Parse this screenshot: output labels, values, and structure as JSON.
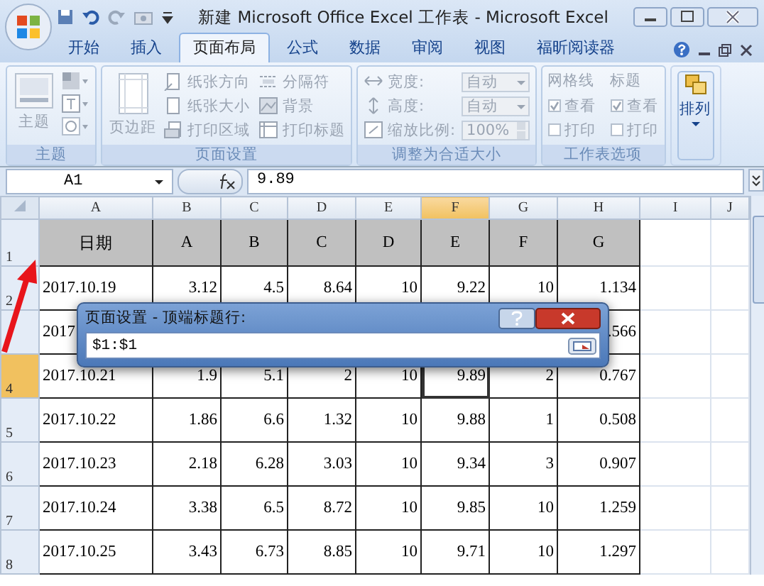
{
  "window": {
    "title": "新建 Microsoft Office Excel 工作表 - Microsoft Excel"
  },
  "tabs": [
    {
      "label": "开始",
      "selected": false
    },
    {
      "label": "插入",
      "selected": false
    },
    {
      "label": "页面布局",
      "selected": true
    },
    {
      "label": "公式",
      "selected": false
    },
    {
      "label": "数据",
      "selected": false
    },
    {
      "label": "审阅",
      "selected": false
    },
    {
      "label": "视图",
      "selected": false
    },
    {
      "label": "福昕阅读器",
      "selected": false
    }
  ],
  "ribbon": {
    "themes": {
      "label": "主题",
      "button": "主题"
    },
    "page_setup": {
      "label": "页面设置",
      "button": "页边距",
      "items": [
        "纸张方向",
        "分隔符",
        "纸张大小",
        "背景",
        "打印区域",
        "打印标题"
      ]
    },
    "scale_to_fit": {
      "label": "调整为合适大小",
      "fields": [
        {
          "label": "宽度:",
          "value": "自动",
          "kind": "dropdown"
        },
        {
          "label": "高度:",
          "value": "自动",
          "kind": "dropdown"
        },
        {
          "label": "缩放比例:",
          "value": "100%",
          "kind": "spinner"
        }
      ]
    },
    "sheet_options": {
      "label": "工作表选项",
      "groups": [
        {
          "label": "网格线",
          "options": [
            {
              "label": "查看",
              "checked": true
            },
            {
              "label": "打印",
              "checked": false
            }
          ]
        },
        {
          "label": "标题",
          "options": [
            {
              "label": "查看",
              "checked": true
            },
            {
              "label": "打印",
              "checked": false
            }
          ]
        }
      ]
    },
    "arrange": {
      "button": "排列"
    }
  },
  "formula_bar": {
    "name_box": "A1",
    "formula": "9.89"
  },
  "columns": [
    {
      "label": "A",
      "selected": false
    },
    {
      "label": "B",
      "selected": false
    },
    {
      "label": "C",
      "selected": false
    },
    {
      "label": "D",
      "selected": false
    },
    {
      "label": "E",
      "selected": false
    },
    {
      "label": "F",
      "selected": true
    },
    {
      "label": "G",
      "selected": false
    },
    {
      "label": "H",
      "selected": false
    },
    {
      "label": "I",
      "selected": false
    },
    {
      "label": "J",
      "selected": false
    }
  ],
  "rows": [
    {
      "number": "1",
      "selected": false,
      "kind": "header",
      "cells": [
        "日期",
        "A",
        "B",
        "C",
        "D",
        "E",
        "F",
        "G"
      ]
    },
    {
      "number": "2",
      "selected": false,
      "kind": "data",
      "cells": [
        "2017.10.19",
        "3.12",
        "4.5",
        "8.64",
        "10",
        "9.22",
        "10",
        "1.134"
      ]
    },
    {
      "selected": false,
      "kind": "data",
      "cells": [
        "2017",
        null,
        null,
        null,
        null,
        null,
        null,
        ".566"
      ]
    },
    {
      "number": "4",
      "selected": true,
      "kind": "data",
      "cells": [
        "2017.10.21",
        "1.9",
        "5.1",
        "2",
        "10",
        "9.89",
        "2",
        "0.767"
      ]
    },
    {
      "number": "5",
      "selected": false,
      "kind": "data",
      "cells": [
        "2017.10.22",
        "1.86",
        "6.6",
        "1.32",
        "10",
        "9.88",
        "1",
        "0.508"
      ]
    },
    {
      "number": "6",
      "selected": false,
      "kind": "data",
      "cells": [
        "2017.10.23",
        "2.18",
        "6.28",
        "3.03",
        "10",
        "9.34",
        "3",
        "0.907"
      ]
    },
    {
      "number": "7",
      "selected": false,
      "kind": "data",
      "cells": [
        "2017.10.24",
        "3.38",
        "6.5",
        "8.72",
        "10",
        "9.85",
        "10",
        "1.259"
      ]
    },
    {
      "number": "8",
      "selected": false,
      "kind": "data",
      "cells": [
        "2017.10.25",
        "3.43",
        "6.73",
        "8.85",
        "10",
        "9.71",
        "10",
        "1.297"
      ]
    }
  ],
  "dialog": {
    "title": "页面设置 - 顶端标题行:",
    "value": "$1:$1"
  }
}
